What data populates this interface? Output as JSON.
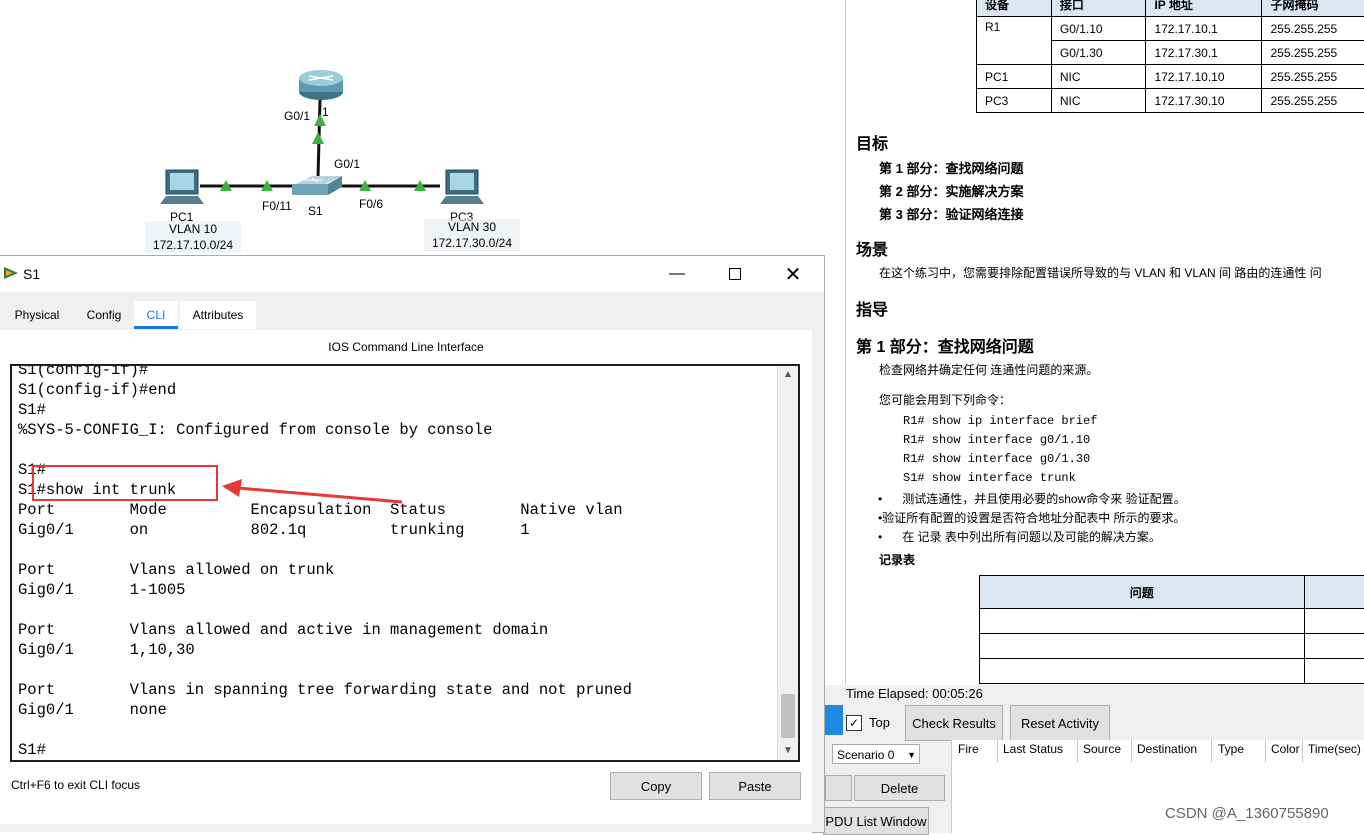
{
  "topology": {
    "router_port_label": "G0/1",
    "router_port_suffix": "1",
    "switch_uplink_label": "G0/1",
    "switch_name": "S1",
    "left_port_label": "F0/11",
    "right_port_label": "F0/6",
    "pc1_label": "PC1",
    "pc3_label": "PC3",
    "vlan10": {
      "name": "VLAN 10",
      "subnet": "172.17.10.0/24"
    },
    "vlan30": {
      "name": "VLAN 30",
      "subnet": "172.17.30.0/24"
    }
  },
  "document": {
    "addr_table": {
      "headers": [
        "设备",
        "接口",
        "IP 地址",
        "子网掩码"
      ],
      "rows": [
        [
          "R1",
          "G0/1.10",
          "172.17.10.1",
          "255.255.255"
        ],
        [
          "",
          "G0/1.30",
          "172.17.30.1",
          "255.255.255"
        ],
        [
          "PC1",
          "NIC",
          "172.17.10.10",
          "255.255.255"
        ],
        [
          "PC3",
          "NIC",
          "172.17.30.10",
          "255.255.255"
        ]
      ]
    },
    "objectives_heading": "目标",
    "objectives": [
      "第 1 部分：查找网络问题",
      "第 2 部分：实施解决方案",
      "第 3 部分：验证网络连接"
    ],
    "scenario_heading": "场景",
    "scenario_text": "在这个练习中，您需要排除配置错误所导致的与 VLAN 和 VLAN 间 路由的连通性 问",
    "instructions_heading": "指导",
    "part1_heading": "第 1 部分：查找网络问题",
    "part1_intro": "检查网络并确定任何 连通性问题的来源。",
    "commands_intro": "您可能会用到下列命令：",
    "commands": [
      "R1# show ip interface brief",
      "R1# show interface g0/1.10",
      "R1# show interface g0/1.30",
      "S1# show interface trunk"
    ],
    "bullets": [
      "测试连通性，并且使用必要的show命令来 验证配置。",
      "验证所有配置的设置是否符合地址分配表中 所示的要求。",
      "在 记录 表中列出所有问题以及可能的解决方案。"
    ],
    "record_table_title": "记录表",
    "record_table_header": "问题"
  },
  "sim_panel": {
    "time_elapsed_label": "Time Elapsed: 00:05:26",
    "top_label": "Top",
    "check_results": "Check Results",
    "reset_activity": "Reset Activity",
    "scenario_select": "Scenario 0",
    "delete_label": "Delete",
    "pdu_list": "PDU List Window",
    "columns": [
      "Fire",
      "Last Status",
      "Source",
      "Destination",
      "Type",
      "Color",
      "Time(sec)"
    ]
  },
  "window": {
    "title": "S1",
    "tabs": [
      "Physical",
      "Config",
      "CLI",
      "Attributes"
    ],
    "active_tab": "CLI",
    "cli_title": "IOS Command Line Interface",
    "terminal_lines": [
      "S1(config-if)#",
      "S1(config-if)#end",
      "S1#",
      "%SYS-5-CONFIG_I: Configured from console by console",
      "",
      "S1#",
      "S1#show int trunk",
      "Port        Mode         Encapsulation  Status        Native vlan",
      "Gig0/1      on           802.1q         trunking      1",
      "",
      "Port        Vlans allowed on trunk",
      "Gig0/1      1-1005",
      "",
      "Port        Vlans allowed and active in management domain",
      "Gig0/1      1,10,30",
      "",
      "Port        Vlans in spanning tree forwarding state and not pruned",
      "Gig0/1      none",
      "",
      "S1#"
    ],
    "hint": "Ctrl+F6 to exit CLI focus",
    "copy_label": "Copy",
    "paste_label": "Paste"
  },
  "watermark": "CSDN @A_1360755890",
  "colors": {
    "accent": "#1a73e8",
    "annotation": "#e53935",
    "link_green": "#3cb043"
  }
}
